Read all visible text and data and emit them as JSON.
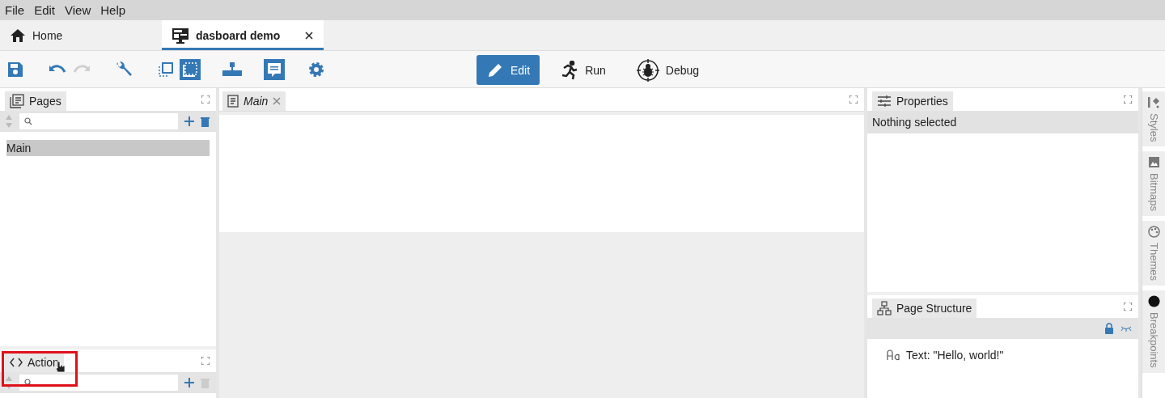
{
  "menu": [
    "File",
    "Edit",
    "View",
    "Help"
  ],
  "tabs": [
    {
      "label": "Home",
      "selected": false
    },
    {
      "label": "dasboard demo",
      "selected": true
    }
  ],
  "toolbar": [
    {
      "kind": "save",
      "selected": false,
      "disabled": false
    },
    {
      "kind": "undo",
      "selected": false,
      "disabled": false
    },
    {
      "kind": "redo",
      "selected": false,
      "disabled": true
    },
    {
      "kind": "wrench",
      "selected": false,
      "disabled": false
    },
    {
      "kind": "outline",
      "selected": false,
      "disabled": false
    },
    {
      "kind": "frame",
      "selected": true,
      "disabled": false
    },
    {
      "kind": "hierarchy",
      "selected": false,
      "disabled": false
    },
    {
      "kind": "comment",
      "selected": true,
      "disabled": false
    },
    {
      "kind": "gear",
      "selected": false,
      "disabled": false
    }
  ],
  "modes": [
    {
      "label": "Edit",
      "selected": true
    },
    {
      "label": "Run",
      "selected": false
    },
    {
      "label": "Debug",
      "selected": false
    }
  ],
  "pages_panel": {
    "title": "Pages",
    "delete_disabled": false,
    "items": [
      {
        "label": "Main",
        "selected": true
      }
    ]
  },
  "actions_panel": {
    "title": "Action",
    "delete_disabled": true,
    "highlighted": true,
    "cursor": true
  },
  "editor": {
    "tab": {
      "label": "Main"
    }
  },
  "properties_panel": {
    "title": "Properties",
    "message": "Nothing selected"
  },
  "structure_panel": {
    "title": "Page Structure",
    "items": [
      {
        "label": "Text: \"Hello, world!\""
      }
    ]
  },
  "side_tabs": [
    {
      "label": "Styles"
    },
    {
      "label": "Bitmaps"
    },
    {
      "label": "Themes"
    },
    {
      "label": "Breakpoints"
    }
  ]
}
